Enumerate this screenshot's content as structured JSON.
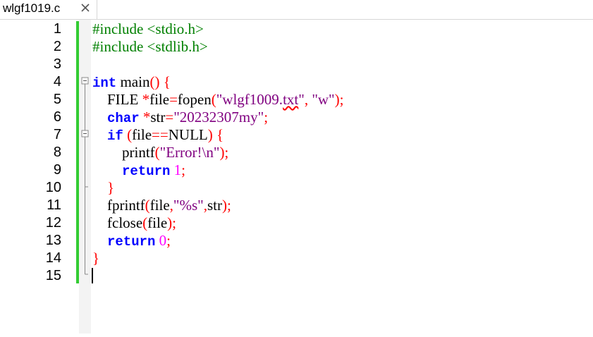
{
  "tab": {
    "label": "wlgf1019.c"
  },
  "line_numbers": [
    "1",
    "2",
    "3",
    "4",
    "5",
    "6",
    "7",
    "8",
    "9",
    "10",
    "11",
    "12",
    "13",
    "14",
    "15"
  ],
  "colors": {
    "change_bar": "#33cc33",
    "keyword": "#0000ff",
    "preprocessor": "#008000",
    "string": "#800080",
    "number": "#ff00ff",
    "operator": "#ff0000"
  },
  "code": [
    {
      "segments": [
        {
          "t": "#include <stdio.h>",
          "c": "pp"
        }
      ]
    },
    {
      "segments": [
        {
          "t": "#include <stdlib.h>",
          "c": "pp"
        }
      ]
    },
    {
      "segments": []
    },
    {
      "segments": [
        {
          "t": "int",
          "c": "kw"
        },
        {
          "t": " main",
          "c": ""
        },
        {
          "t": "()",
          "c": "op"
        },
        {
          "t": " {",
          "c": "op"
        }
      ]
    },
    {
      "segments": [
        {
          "t": "    FILE ",
          "c": ""
        },
        {
          "t": "*",
          "c": "op"
        },
        {
          "t": "file",
          "c": ""
        },
        {
          "t": "=",
          "c": "op"
        },
        {
          "t": "fopen",
          "c": ""
        },
        {
          "t": "(",
          "c": "op"
        },
        {
          "t": "\"wlgf1009.",
          "c": "str"
        },
        {
          "t": "txt",
          "c": "str tilde"
        },
        {
          "t": "\"",
          "c": "str"
        },
        {
          "t": ", ",
          "c": "op"
        },
        {
          "t": "\"w\"",
          "c": "str"
        },
        {
          "t": ");",
          "c": "op"
        }
      ]
    },
    {
      "segments": [
        {
          "t": "    ",
          "c": ""
        },
        {
          "t": "char",
          "c": "kw"
        },
        {
          "t": " ",
          "c": ""
        },
        {
          "t": "*",
          "c": "op"
        },
        {
          "t": "str",
          "c": ""
        },
        {
          "t": "=",
          "c": "op"
        },
        {
          "t": "\"20232307my\"",
          "c": "str"
        },
        {
          "t": ";",
          "c": "op"
        }
      ]
    },
    {
      "segments": [
        {
          "t": "    ",
          "c": ""
        },
        {
          "t": "if",
          "c": "kw"
        },
        {
          "t": " ",
          "c": ""
        },
        {
          "t": "(",
          "c": "op"
        },
        {
          "t": "file",
          "c": ""
        },
        {
          "t": "==",
          "c": "op"
        },
        {
          "t": "NULL",
          "c": ""
        },
        {
          "t": ")",
          "c": "op"
        },
        {
          "t": " {",
          "c": "op"
        }
      ]
    },
    {
      "segments": [
        {
          "t": "        printf",
          "c": ""
        },
        {
          "t": "(",
          "c": "op"
        },
        {
          "t": "\"Error!\\n\"",
          "c": "str"
        },
        {
          "t": ");",
          "c": "op"
        }
      ]
    },
    {
      "segments": [
        {
          "t": "        ",
          "c": ""
        },
        {
          "t": "return",
          "c": "kw"
        },
        {
          "t": " ",
          "c": ""
        },
        {
          "t": "1",
          "c": "num"
        },
        {
          "t": ";",
          "c": "op"
        }
      ]
    },
    {
      "segments": [
        {
          "t": "    }",
          "c": "op"
        }
      ]
    },
    {
      "segments": [
        {
          "t": "    fprintf",
          "c": ""
        },
        {
          "t": "(",
          "c": "op"
        },
        {
          "t": "file",
          "c": ""
        },
        {
          "t": ",",
          "c": "op"
        },
        {
          "t": "\"%s\"",
          "c": "str"
        },
        {
          "t": ",",
          "c": "op"
        },
        {
          "t": "str",
          "c": ""
        },
        {
          "t": ");",
          "c": "op"
        }
      ]
    },
    {
      "segments": [
        {
          "t": "    fclose",
          "c": ""
        },
        {
          "t": "(",
          "c": "op"
        },
        {
          "t": "file",
          "c": ""
        },
        {
          "t": ");",
          "c": "op"
        }
      ]
    },
    {
      "segments": [
        {
          "t": "    ",
          "c": ""
        },
        {
          "t": "return",
          "c": "kw"
        },
        {
          "t": " ",
          "c": ""
        },
        {
          "t": "0",
          "c": "num"
        },
        {
          "t": ";",
          "c": "op"
        }
      ]
    },
    {
      "segments": [
        {
          "t": "}",
          "c": "op"
        }
      ]
    },
    {
      "segments": []
    }
  ]
}
